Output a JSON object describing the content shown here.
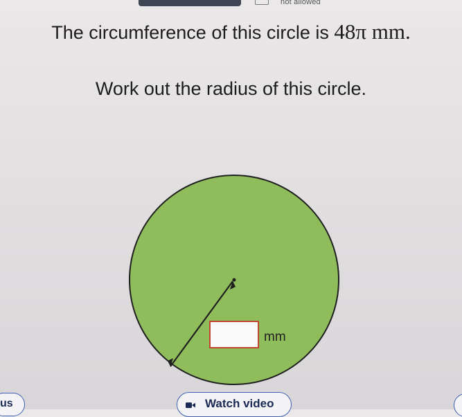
{
  "status": {
    "calculator_icon": "calculator-icon",
    "calculator_text": "not allowed"
  },
  "question": {
    "text_before": "The circumference of this circle is ",
    "value": "48π",
    "unit": " mm."
  },
  "instruction": "Work out the radius of this circle.",
  "answer": {
    "value": "",
    "placeholder": "",
    "unit": "mm"
  },
  "colors": {
    "circle_fill": "#8fbd5c",
    "answer_border": "#c0442e",
    "button_border": "#3d5fb0",
    "button_text": "#1a2a55"
  },
  "buttons": {
    "left_partial_label": "us",
    "watch_video_label": "Watch video",
    "watch_video_icon": "video-camera-icon"
  }
}
